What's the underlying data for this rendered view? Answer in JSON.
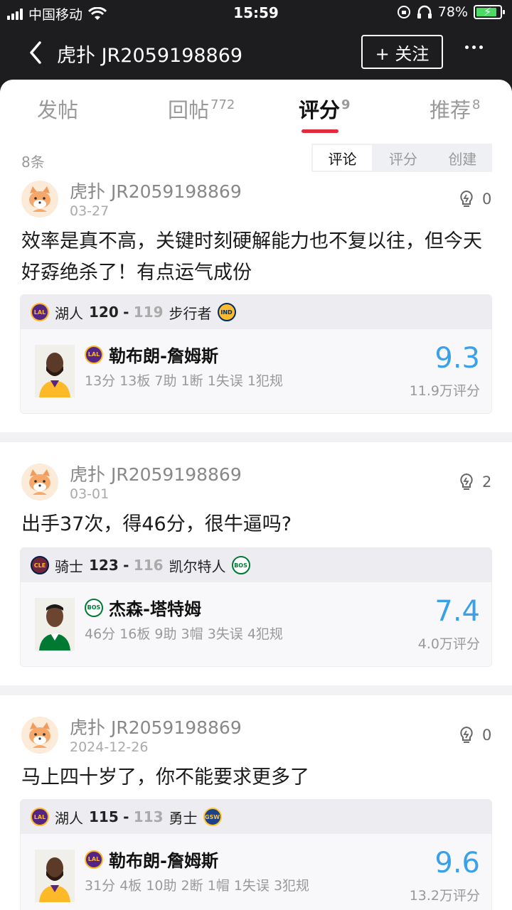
{
  "status_bar": {
    "carrier": "中国移动",
    "time": "15:59",
    "battery": "78%"
  },
  "header": {
    "title": "虎扑 JR2059198869",
    "follow_label": "+ 关注"
  },
  "tabs": [
    {
      "label": "发帖",
      "count": ""
    },
    {
      "label": "回帖",
      "count": "772"
    },
    {
      "label": "评分",
      "count": "9"
    },
    {
      "label": "推荐",
      "count": "8"
    }
  ],
  "filter": {
    "count_label": "8条",
    "options": [
      "评论",
      "评分",
      "创建"
    ],
    "selected": "评论"
  },
  "posts": [
    {
      "user": "虎扑 JR2059198869",
      "date": "03-27",
      "likes": "0",
      "text": "效率是真不高，关键时刻硬解能力也不复以往，但今天好孬绝杀了！有点运气成份",
      "game": {
        "home_team": "湖人",
        "home_score": "120",
        "sep": "-",
        "away_score": "119",
        "away_team": "步行者",
        "home_logo": "LAL",
        "away_logo": "IND"
      },
      "player": {
        "name": "勒布朗-詹姆斯",
        "team_logo": "LAL",
        "stats": "13分 13板 7助 1断 1失误 1犯规",
        "rating": "9.3",
        "votes": "11.9万评分"
      }
    },
    {
      "user": "虎扑 JR2059198869",
      "date": "03-01",
      "likes": "2",
      "text": "出手37次，得46分，很牛逼吗?",
      "game": {
        "home_team": "骑士",
        "home_score": "123",
        "sep": "-",
        "away_score": "116",
        "away_team": "凯尔特人",
        "home_logo": "CLE",
        "away_logo": "BOS"
      },
      "player": {
        "name": "杰森-塔特姆",
        "team_logo": "BOS",
        "stats": "46分 16板 9助 3帽 3失误 4犯规",
        "rating": "7.4",
        "votes": "4.0万评分"
      }
    },
    {
      "user": "虎扑 JR2059198869",
      "date": "2024-12-26",
      "likes": "0",
      "text": "马上四十岁了，你不能要求更多了",
      "game": {
        "home_team": "湖人",
        "home_score": "115",
        "sep": "-",
        "away_score": "113",
        "away_team": "勇士",
        "home_logo": "LAL",
        "away_logo": "GSW"
      },
      "player": {
        "name": "勒布朗-詹姆斯",
        "team_logo": "LAL",
        "stats": "31分 4板 10助 2断 1帽 1失误 3犯规",
        "rating": "9.6",
        "votes": "13.2万评分"
      }
    }
  ]
}
